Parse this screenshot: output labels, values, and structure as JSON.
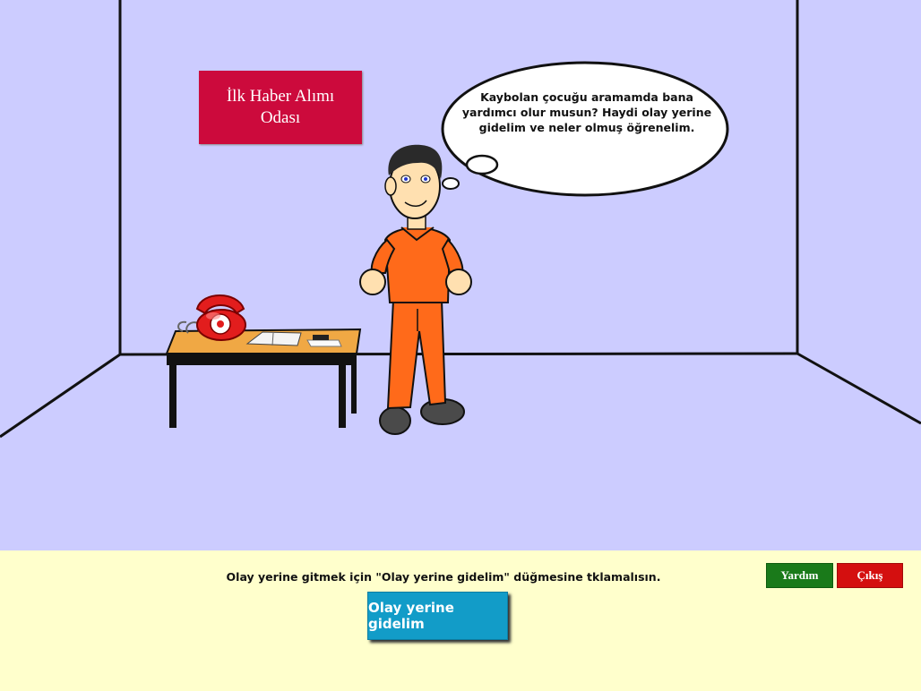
{
  "scene": {
    "sign_text": "İlk Haber Alımı Odası",
    "speech_bubble": "Kaybolan çocuğu aramamda bana yardımcı olur musun? Haydi olay yerine gidelim ve neler olmuş öğrenelim."
  },
  "bottom_panel": {
    "instruction": "Olay yerine gitmek için \"Olay yerine gidelim\" düğmesine tklamalısın.",
    "goto_button_label": "Olay yerine gidelim",
    "help_button_label": "Yardım",
    "exit_button_label": "Çıkış"
  },
  "colors": {
    "wall": "#ccccff",
    "sign": "#cc0a3c",
    "panel": "#ffffcc",
    "goto_button": "#129cc8",
    "help_button": "#1a7a1a",
    "exit_button": "#d40f0f"
  },
  "icons": {
    "phone": "red-rotary-phone-icon",
    "character": "detective-character"
  }
}
